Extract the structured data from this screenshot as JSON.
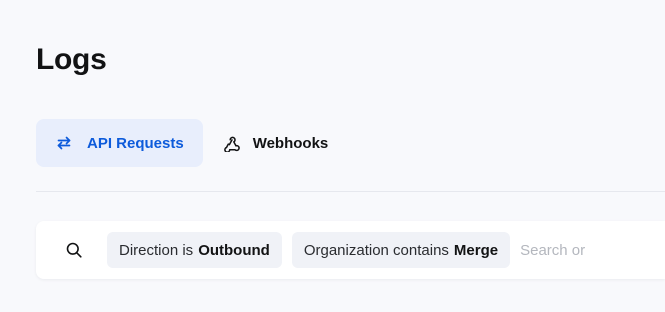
{
  "page": {
    "title": "Logs"
  },
  "tabs": [
    {
      "label": "API Requests",
      "icon": "arrows-exchange-icon",
      "active": true
    },
    {
      "label": "Webhooks",
      "icon": "webhook-icon",
      "active": false
    }
  ],
  "filters": {
    "search_icon": "search-icon",
    "chips": [
      {
        "field": "Direction is",
        "value": "Outbound"
      },
      {
        "field": "Organization contains",
        "value": "Merge"
      }
    ],
    "placeholder": "Search or"
  },
  "colors": {
    "accent": "#0d5bdb",
    "active_tab_bg": "#e8eefc",
    "page_bg": "#f8f9fc",
    "chip_bg": "#f0f2f7"
  }
}
